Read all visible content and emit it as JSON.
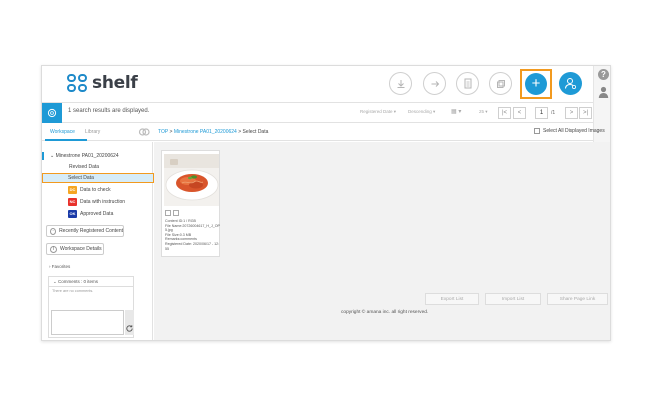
{
  "header": {
    "logo_text": "shelf",
    "plus_symbol": "+",
    "icons": [
      "download-icon",
      "share-icon",
      "document-icon",
      "duplicate-icon",
      "plus-icon",
      "user-settings-icon"
    ],
    "accent_color": "#1e9ad6",
    "highlight_color": "#f29a1f"
  },
  "side_icons": {
    "help": "?"
  },
  "toolbar": {
    "results_text": "1 search results are displayed.",
    "sort_label": "Registered Date ▾",
    "order_label": "Descending ▾",
    "view_label": "▦ ▾",
    "count_label": "25 ▾",
    "page_first": "|<",
    "page_prev": "<",
    "page_current": "1",
    "page_total": "/1",
    "page_next": ">",
    "page_last": ">|"
  },
  "tabs": {
    "workspace": "Workspace",
    "library": "Library"
  },
  "breadcrumb": {
    "top": "TOP",
    "sep1": ">",
    "folder": "Minestrone PA01_20200624",
    "sep2": ">",
    "current": "Select Data"
  },
  "select_all": "Select All Displayed Images",
  "sidebar": {
    "root": "Minestrone PA01_20200624",
    "items": [
      "Revised Data",
      "Select Data"
    ],
    "statuses": [
      {
        "code": "DC",
        "label": "Data to check",
        "color": "#f5a623"
      },
      {
        "code": "NC",
        "label": "Data with instruction",
        "color": "#e8312b"
      },
      {
        "code": "OK",
        "label": "Approved Data",
        "color": "#1a3aa8"
      }
    ],
    "recent_button": "Recently Registered Content",
    "details_button": "Workspace Details",
    "favorites": "Favorites",
    "comments_header": "Comments : 0 items",
    "comments_empty": "There are no comments."
  },
  "card": {
    "meta": "Content ID:1 / RGB\nFile Name:20726004617_H_J_OP5.jpg\nFile Size:0.3 MB\nRemarks:comments\nRegistered Date: 2020/06/17 - 12:55"
  },
  "footer": {
    "export_list": "Export List",
    "import_list": "Import List",
    "share_page_link": "Share Page Link",
    "copyright": "copyright © amana inc. all right reserved."
  }
}
